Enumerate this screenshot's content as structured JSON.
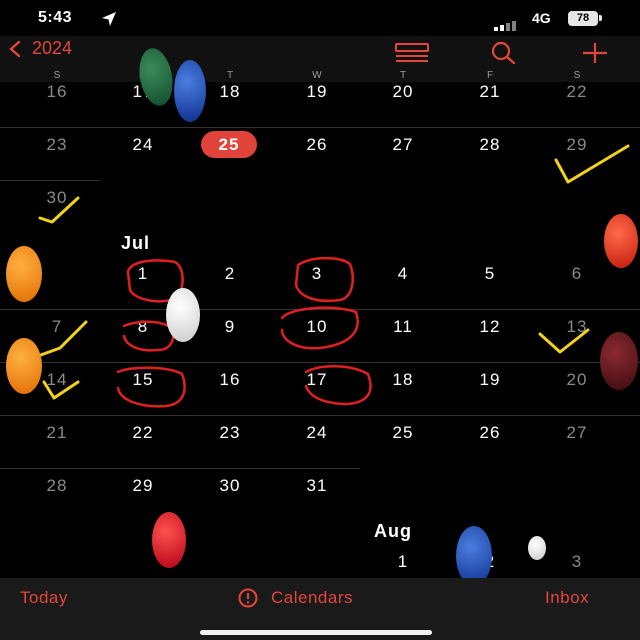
{
  "status": {
    "time": "5:43",
    "network": "4G",
    "battery": "78"
  },
  "nav": {
    "back_label": "2024"
  },
  "weekdays": [
    "S",
    "M",
    "T",
    "W",
    "T",
    "F",
    "S"
  ],
  "calendar": {
    "june_rows": [
      [
        "16",
        "17",
        "18",
        "19",
        "20",
        "21",
        "22"
      ],
      [
        "23",
        "24",
        "25",
        "26",
        "27",
        "28",
        "29"
      ],
      [
        "30"
      ]
    ],
    "today": "25",
    "jul_label": "Jul",
    "jul_rows": [
      [
        "1",
        "2",
        "3",
        "4",
        "5",
        "6"
      ],
      [
        "7",
        "8",
        "9",
        "10",
        "11",
        "12",
        "13"
      ],
      [
        "14",
        "15",
        "16",
        "17",
        "18",
        "19",
        "20"
      ],
      [
        "21",
        "22",
        "23",
        "24",
        "25",
        "26",
        "27"
      ],
      [
        "28",
        "29",
        "30",
        "31"
      ]
    ],
    "aug_label": "Aug",
    "aug_row": [
      "1",
      "2",
      "3"
    ]
  },
  "tabs": {
    "today": "Today",
    "calendars": "Calendars",
    "inbox": "Inbox"
  },
  "colors": {
    "accent": "#e3463a",
    "background": "#000000",
    "annotation_yellow": "#f2d21b",
    "annotation_red": "#e02020"
  }
}
